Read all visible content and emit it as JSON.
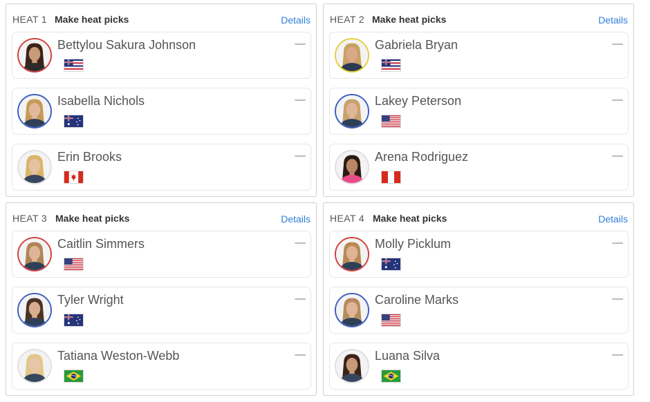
{
  "heats": [
    {
      "label": "HEAT 1",
      "picks_label": "Make heat picks",
      "details_label": "Details",
      "surfers": [
        {
          "name": "Bettylou Sakura Johnson",
          "score": "––",
          "flag": "hawaii-flag-icon",
          "jersey": "red",
          "hair": "#3a2418",
          "skin": "#c99a78",
          "suit": "#2b2b2b"
        },
        {
          "name": "Isabella Nichols",
          "score": "––",
          "flag": "australia-flag-icon",
          "jersey": "blue",
          "hair": "#c59a58",
          "skin": "#e2b89a",
          "suit": "#2f3f58"
        },
        {
          "name": "Erin Brooks",
          "score": "––",
          "flag": "canada-flag-icon",
          "jersey": "grey",
          "hair": "#d9b56a",
          "skin": "#e7c1a3",
          "suit": "#36465e"
        }
      ]
    },
    {
      "label": "HEAT 2",
      "picks_label": "Make heat picks",
      "details_label": "Details",
      "surfers": [
        {
          "name": "Gabriela Bryan",
          "score": "––",
          "flag": "hawaii-flag-icon",
          "jersey": "yellow",
          "hair": "#c7a264",
          "skin": "#d9a98a",
          "suit": "#2a3a50"
        },
        {
          "name": "Lakey Peterson",
          "score": "––",
          "flag": "usa-flag-icon",
          "jersey": "blue",
          "hair": "#c7a26b",
          "skin": "#e0b69a",
          "suit": "#2f3f58"
        },
        {
          "name": "Arena Rodriguez",
          "score": "––",
          "flag": "peru-flag-icon",
          "jersey": "grey",
          "hair": "#2a1a12",
          "skin": "#b98766",
          "suit": "#e84a8a"
        }
      ]
    },
    {
      "label": "HEAT 3",
      "picks_label": "Make heat picks",
      "details_label": "Details",
      "surfers": [
        {
          "name": "Caitlin Simmers",
          "score": "––",
          "flag": "usa-flag-icon",
          "jersey": "red",
          "hair": "#b08456",
          "skin": "#e0b597",
          "suit": "#2f3f58"
        },
        {
          "name": "Tyler Wright",
          "score": "––",
          "flag": "australia-flag-icon",
          "jersey": "blue",
          "hair": "#4a3324",
          "skin": "#d9ad8f",
          "suit": "#2f3f58"
        },
        {
          "name": "Tatiana Weston-Webb",
          "score": "––",
          "flag": "brazil-flag-icon",
          "jersey": "grey",
          "hair": "#e2c88a",
          "skin": "#e8c5a8",
          "suit": "#36465e"
        }
      ]
    },
    {
      "label": "HEAT 4",
      "picks_label": "Make heat picks",
      "details_label": "Details",
      "surfers": [
        {
          "name": "Molly Picklum",
          "score": "––",
          "flag": "australia-flag-icon",
          "jersey": "red",
          "hair": "#b88a52",
          "skin": "#e0b394",
          "suit": "#2f3f58"
        },
        {
          "name": "Caroline Marks",
          "score": "––",
          "flag": "usa-flag-icon",
          "jersey": "blue",
          "hair": "#b58c5e",
          "skin": "#e0b597",
          "suit": "#2f3f58"
        },
        {
          "name": "Luana Silva",
          "score": "––",
          "flag": "brazil-flag-icon",
          "jersey": "grey",
          "hair": "#3a2418",
          "skin": "#c99a7a",
          "suit": "#36465e"
        }
      ]
    }
  ],
  "colors": {
    "accent_link": "#2e7fd9",
    "jersey_red": "#d2403d",
    "jersey_blue": "#3d5ec1",
    "jersey_yellow": "#e4cf3c"
  }
}
